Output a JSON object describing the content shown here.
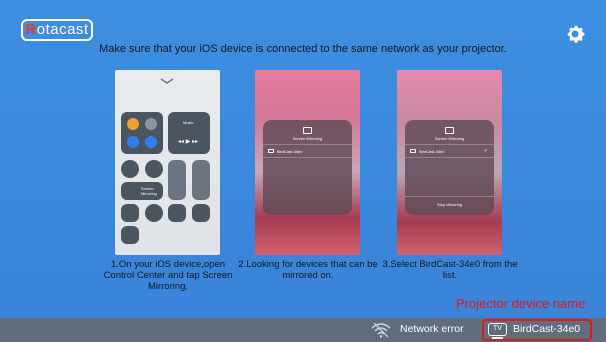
{
  "header": {
    "logo_first": "R",
    "logo_rest": "otacast",
    "instruction": "Make sure that your iOS device is connected to the same network as your projector."
  },
  "steps": [
    {
      "caption": "1.On your iOS device,open Control Center and tap Screen Mirroring.",
      "screen": {
        "music": "Music",
        "mirroring_a": "Screen",
        "mirroring_b": "Mirroring"
      }
    },
    {
      "caption": "2.Looking for devices that can be mirrored on.",
      "screen": {
        "title": "Screen Mirroring",
        "device": "BirdCast-34e0"
      }
    },
    {
      "caption": "3.Select BirdCast-34e0 from the list.",
      "screen": {
        "title": "Screen Mirroring",
        "device": "BirdCast-34e0",
        "stop": "Stop Mirroring"
      }
    }
  ],
  "annotation": "Projector device name",
  "status_bar": {
    "network_status": "Network error",
    "tv_label": "TV",
    "device_name": "BirdCast-34e0"
  },
  "icons": {
    "settings": "gear-icon",
    "network": "wifi-icon",
    "device": "tv-icon"
  },
  "colors": {
    "background": "#3d8fe0",
    "status_bar": "#5f6d7d",
    "annotation": "#e01a1a",
    "logo_accent": "#e63a2e"
  }
}
